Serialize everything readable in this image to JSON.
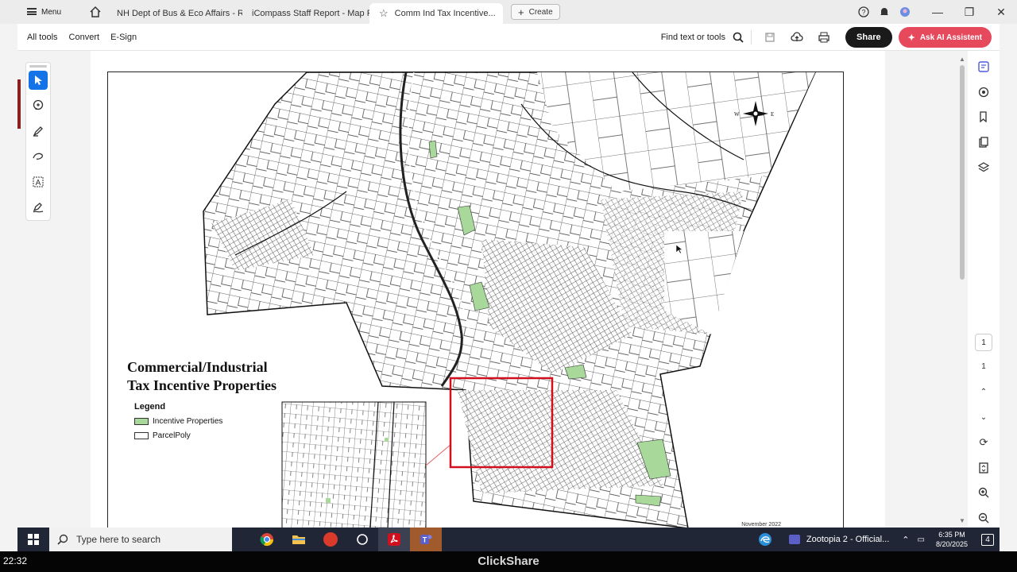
{
  "tabbar": {
    "menu_label": "Menu",
    "tabs": [
      {
        "label": "NH Dept of Bus & Eco Affairs - R..."
      },
      {
        "label": "iCompass Staff Report - Map Pg..."
      },
      {
        "label": "Comm Ind Tax Incentive..."
      }
    ],
    "create_label": "Create"
  },
  "toolbar": {
    "all_tools": "All tools",
    "convert": "Convert",
    "esign": "E-Sign",
    "find_label": "Find text or tools",
    "share_label": "Share",
    "ai_label": "Ask AI Assistent"
  },
  "document": {
    "map_title_line1": "Commercial/Industrial",
    "map_title_line2": "Tax Incentive Properties",
    "legend_title": "Legend",
    "legend_items": [
      {
        "label": "Incentive Properties",
        "color": "#a8d89a"
      },
      {
        "label": "ParcelPoly",
        "color": "#ffffff"
      }
    ],
    "date_note": "November 2022",
    "compass": {
      "west": "W",
      "east": "E"
    }
  },
  "rightpanel": {
    "page_current": "1",
    "page_total": "1"
  },
  "taskbar": {
    "search_placeholder": "Type here to search",
    "media_label": "Zootopia 2 - Official...",
    "time": "6:35 PM",
    "date": "8/20/2025",
    "notif_count": "4"
  },
  "overlay": {
    "rec_time": "22:32",
    "brand": "ClickShare"
  },
  "colors": {
    "accent_blue": "#1473e6",
    "ai_button": "#e6485c",
    "highlight_red": "#d0101e",
    "incentive_green": "#a8d89a"
  }
}
